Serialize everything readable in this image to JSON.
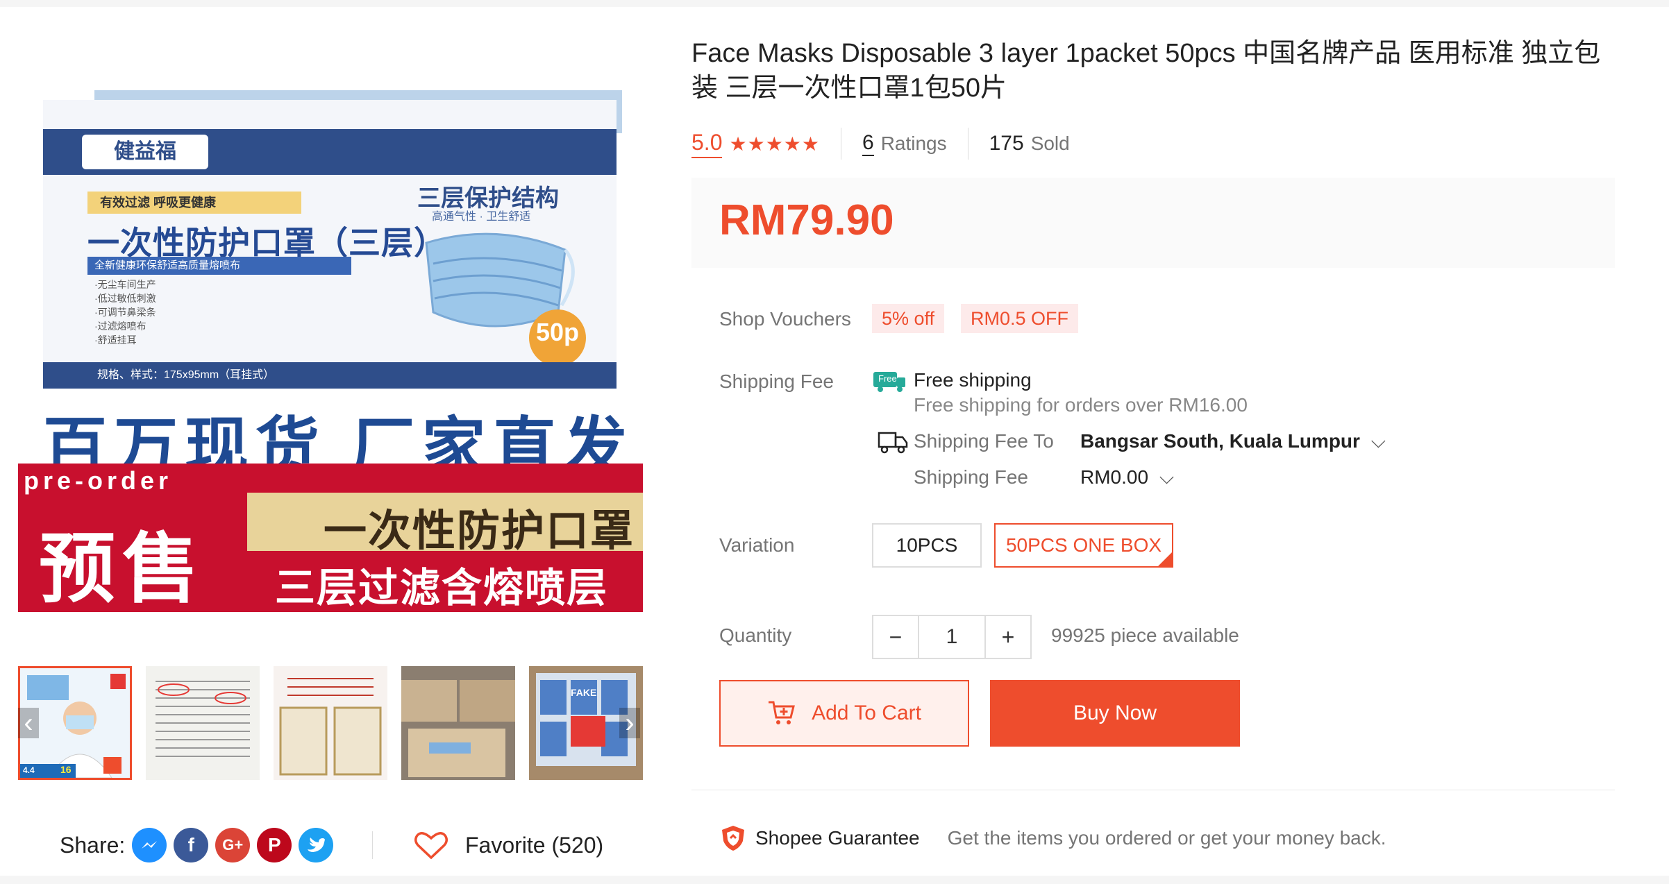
{
  "product": {
    "title": "Face Masks Disposable 3 layer 1packet 50pcs 中国名牌产品 医用标准 独立包装 三层一次性口罩1包50片",
    "rating": "5.0",
    "stars": "★★★★★",
    "ratings_count": "6",
    "ratings_label": "Ratings",
    "sold_count": "175",
    "sold_label": "Sold",
    "price": "RM79.90"
  },
  "image": {
    "brand": "健益福",
    "tag": "有效过滤 呼吸更健康",
    "box_title": "一次性防护口罩（三层）",
    "strip": "全新健康环保舒适高质量熔喷布",
    "bullets": [
      "·无尘车间生产",
      "·低过敏低刺激",
      "·可调节鼻梁条",
      "·过滤熔喷布",
      "·舒适挂耳"
    ],
    "spec": "规格、样式：175x95mm（耳挂式）",
    "right_title": "三层保护结构",
    "right_sub": "高通气性 · 卫生舒适",
    "badge": "50p",
    "big_cn": "百万现货 厂家直发",
    "preorder": "pre-order",
    "yushou": "预售",
    "gold_text": "一次性防护口罩",
    "red_text": "三层过滤含熔喷层"
  },
  "vouchers": {
    "label": "Shop Vouchers",
    "items": [
      "5% off",
      "RM0.5 OFF"
    ]
  },
  "shipping": {
    "label": "Shipping Fee",
    "free_badge": "Free",
    "free_title": "Free shipping",
    "free_desc": "Free shipping for orders over RM16.00",
    "to_label": "Shipping Fee To",
    "to_value": "Bangsar South, Kuala Lumpur",
    "fee_label": "Shipping Fee",
    "fee_value": "RM0.00"
  },
  "variation": {
    "label": "Variation",
    "options": [
      "10PCS",
      "50PCS ONE BOX"
    ],
    "selected": "50PCS ONE BOX"
  },
  "quantity": {
    "label": "Quantity",
    "minus": "−",
    "value": "1",
    "plus": "+",
    "available": "99925 piece available"
  },
  "buttons": {
    "add_to_cart": "Add To Cart",
    "buy_now": "Buy Now"
  },
  "guarantee": {
    "name": "Shopee Guarantee",
    "desc": "Get the items you ordered or get your money back."
  },
  "share": {
    "label": "Share:",
    "icons": [
      "messenger-icon",
      "facebook-icon",
      "google-plus-icon",
      "pinterest-icon",
      "twitter-icon"
    ]
  },
  "favorite": {
    "label": "Favorite (520)"
  },
  "thumbnails": {
    "count": 5,
    "thumb1_badge": "4.4",
    "thumb1_number": "16",
    "thumb5_label": "FAKE"
  },
  "colors": {
    "accent": "#ee4d2d",
    "box_blue": "#2f4e8a",
    "banner_red": "#c8102e"
  }
}
